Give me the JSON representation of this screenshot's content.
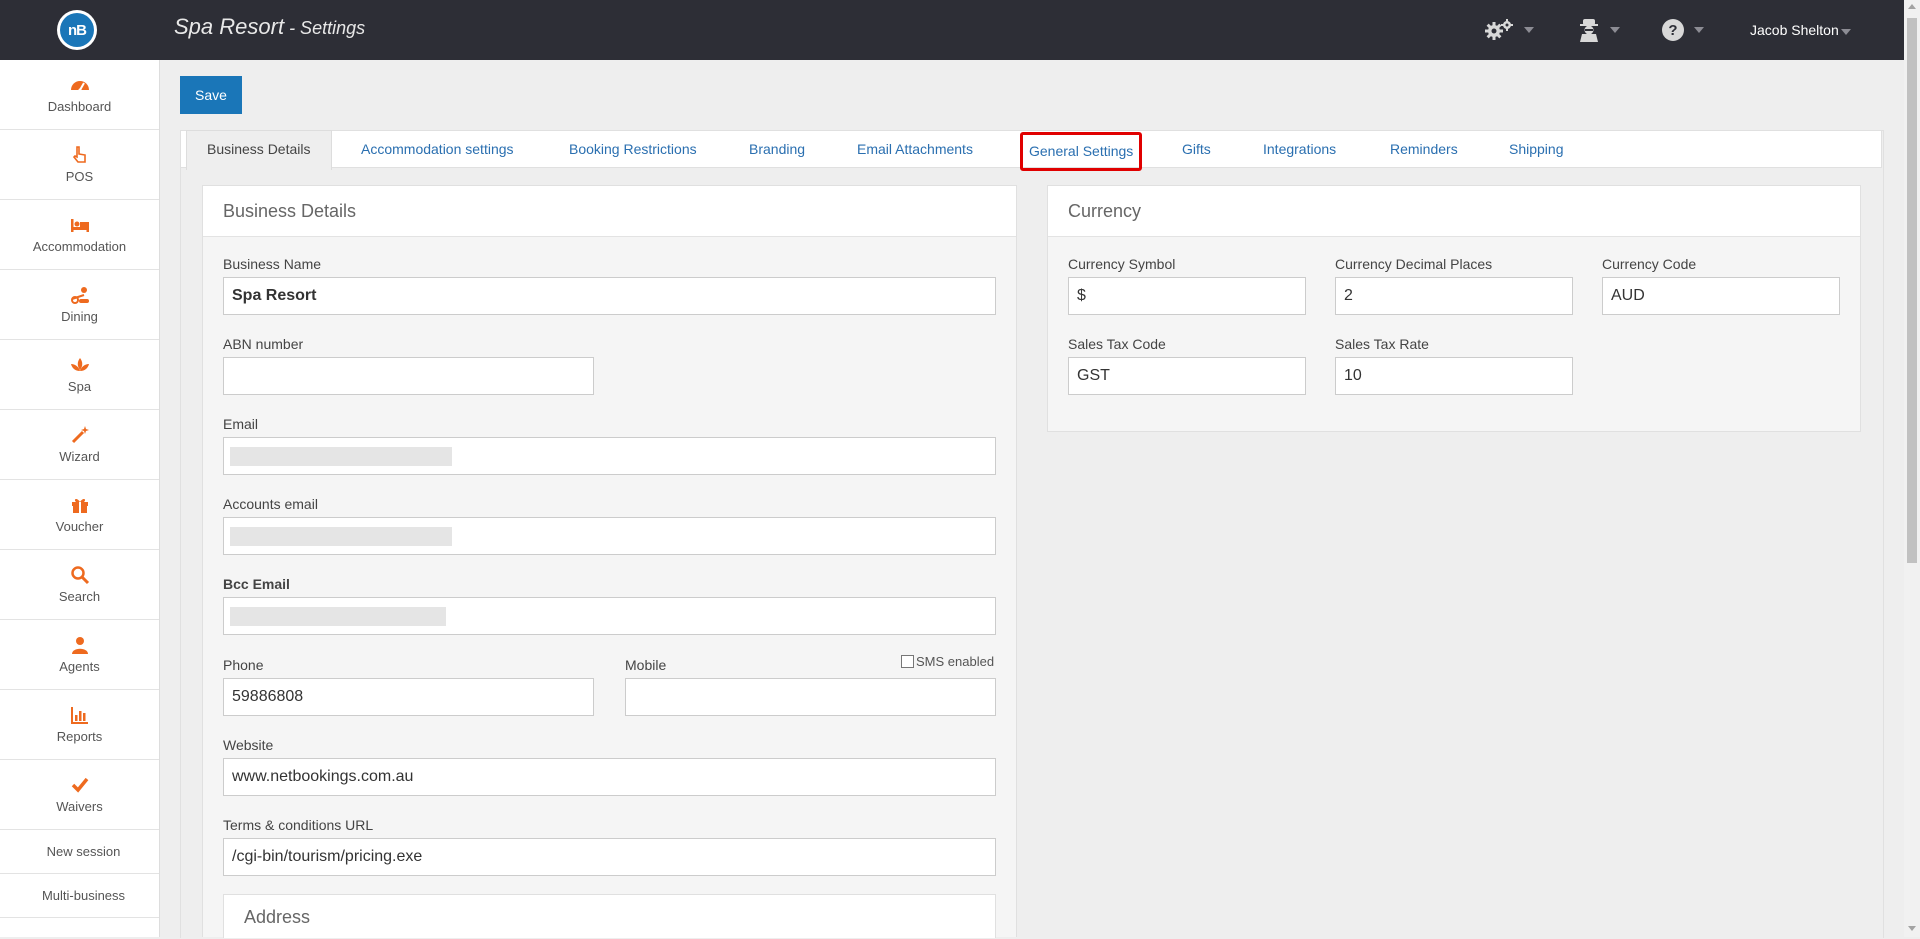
{
  "header": {
    "logo_text": "nB",
    "title": "Spa Resort",
    "subtitle": " - Settings",
    "user_name": "Jacob Shelton"
  },
  "sidebar": {
    "items": [
      {
        "label": "Dashboard",
        "icon": "dashboard-icon"
      },
      {
        "label": "POS",
        "icon": "hand-pointer-icon"
      },
      {
        "label": "Accommodation",
        "icon": "bed-icon"
      },
      {
        "label": "Dining",
        "icon": "dining-icon"
      },
      {
        "label": "Spa",
        "icon": "lotus-icon"
      },
      {
        "label": "Wizard",
        "icon": "magic-wand-icon"
      },
      {
        "label": "Voucher",
        "icon": "gift-icon"
      },
      {
        "label": "Search",
        "icon": "search-icon"
      },
      {
        "label": "Agents",
        "icon": "user-icon"
      },
      {
        "label": "Reports",
        "icon": "bar-chart-icon"
      },
      {
        "label": "Waivers",
        "icon": "check-icon"
      }
    ],
    "links": [
      "New session",
      "Multi-business"
    ],
    "icon_color": "#ee6a1f"
  },
  "toolbar": {
    "save_label": "Save"
  },
  "tabs": [
    "Business Details",
    "Accommodation settings",
    "Booking Restrictions",
    "Branding",
    "Email Attachments",
    "General Settings",
    "Gifts",
    "Integrations",
    "Reminders",
    "Shipping"
  ],
  "business": {
    "heading": "Business Details",
    "name_label": "Business Name",
    "name_value": "Spa Resort",
    "abn_label": "ABN number",
    "abn_value": "",
    "email_label": "Email",
    "accounts_email_label": "Accounts email",
    "bcc_email_label": "Bcc Email",
    "phone_label": "Phone",
    "phone_value": "59886808",
    "mobile_label": "Mobile",
    "mobile_value": "",
    "sms_label": "SMS enabled",
    "website_label": "Website",
    "website_value": "www.netbookings.com.au",
    "terms_label": "Terms & conditions URL",
    "terms_value": "/cgi-bin/tourism/pricing.exe",
    "address_heading": "Address"
  },
  "currency": {
    "heading": "Currency",
    "symbol_label": "Currency Symbol",
    "symbol_value": "$",
    "decimal_label": "Currency Decimal Places",
    "decimal_value": "2",
    "code_label": "Currency Code",
    "code_value": "AUD",
    "tax_code_label": "Sales Tax Code",
    "tax_code_value": "GST",
    "tax_rate_label": "Sales Tax Rate",
    "tax_rate_value": "10"
  },
  "colors": {
    "topbar": "#2d2e36",
    "primary": "#1a76b8",
    "link": "#2a6fb0",
    "highlight": "#e00000"
  }
}
